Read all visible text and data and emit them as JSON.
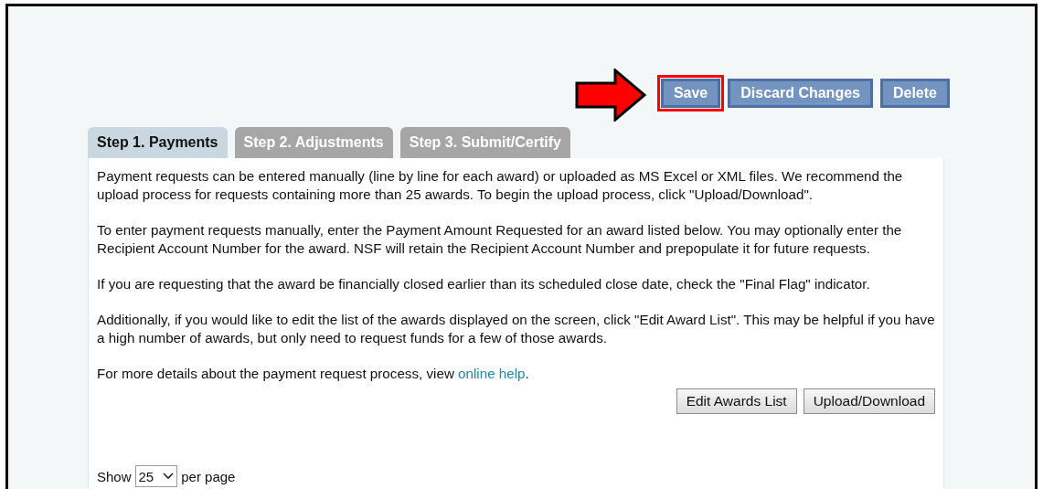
{
  "actions": [
    {
      "label": "Save",
      "highlighted": true
    },
    {
      "label": "Discard Changes",
      "highlighted": false
    },
    {
      "label": "Delete",
      "highlighted": false
    }
  ],
  "tabs": [
    {
      "label": "Step 1. Payments",
      "selected": true
    },
    {
      "label": "Step 2. Adjustments",
      "selected": false
    },
    {
      "label": "Step 3. Submit/Certify",
      "selected": false
    }
  ],
  "paragraphs": [
    "Payment requests can be entered manually (line by line for each award) or uploaded as MS Excel or XML files. We recommend the upload process for requests containing more than 25 awards. To begin the upload process, click \"Upload/Download\".",
    "To enter payment requests manually, enter the Payment Amount Requested for an award listed below. You may optionally enter the Recipient Account Number for the award. NSF will retain the Recipient Account Number and prepopulate it for future requests.",
    "If you are requesting that the award be financially closed earlier than its scheduled close date, check the \"Final Flag\" indicator.",
    "Additionally, if you would like to edit the list of the awards displayed on the screen, click \"Edit Award List\". This may be helpful if you have a high number of awards, but only need to request funds for a few of those awards."
  ],
  "help": {
    "before": "For more details about the payment request process, view ",
    "link": "online help",
    "after": "."
  },
  "panel_buttons": [
    "Edit Awards List",
    "Upload/Download"
  ],
  "paging": {
    "prefix": "Show",
    "value": "25",
    "suffix": "per page"
  }
}
